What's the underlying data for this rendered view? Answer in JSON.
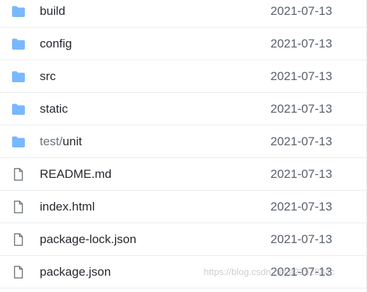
{
  "colors": {
    "folder": "#79b8ff",
    "file_outline": "#6a737d",
    "divider": "#eaecef",
    "date": "#586069"
  },
  "rows": [
    {
      "type": "folder",
      "icon": "folder-icon",
      "name": "build",
      "date": "2021-07-13"
    },
    {
      "type": "folder",
      "icon": "folder-icon",
      "name": "config",
      "date": "2021-07-13"
    },
    {
      "type": "folder",
      "icon": "folder-icon",
      "name": "src",
      "date": "2021-07-13"
    },
    {
      "type": "folder",
      "icon": "folder-icon",
      "name": "static",
      "date": "2021-07-13"
    },
    {
      "type": "folder",
      "icon": "folder-icon",
      "name_prefix": "test/",
      "name": "unit",
      "date": "2021-07-13"
    },
    {
      "type": "file",
      "icon": "file-icon",
      "name": "README.md",
      "date": "2021-07-13"
    },
    {
      "type": "file",
      "icon": "file-icon",
      "name": "index.html",
      "date": "2021-07-13"
    },
    {
      "type": "file",
      "icon": "file-icon",
      "name": "package-lock.json",
      "date": "2021-07-13"
    },
    {
      "type": "file",
      "icon": "file-icon",
      "name": "package.json",
      "date": "2021-07-13"
    }
  ],
  "watermark": "https://blog.csdn.net/a2252884c"
}
